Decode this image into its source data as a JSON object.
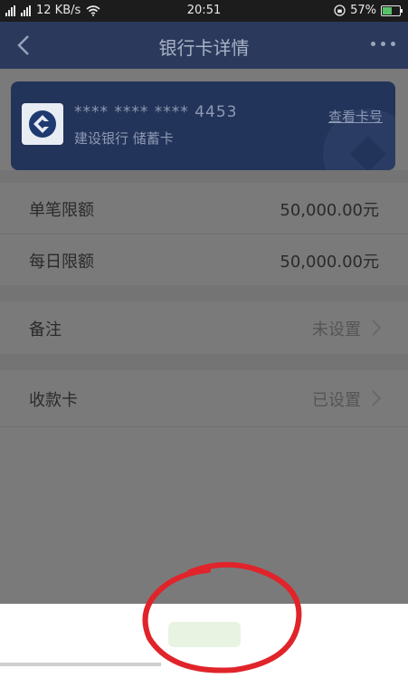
{
  "status_bar": {
    "speed": "12 KB/s",
    "time": "20:51",
    "battery": "57%",
    "battery_level": 0.57
  },
  "header": {
    "title": "银行卡详情"
  },
  "card": {
    "number": "**** **** **** 4453",
    "bank": "建设银行 储蓄卡",
    "view_label": "查看卡号"
  },
  "limits": [
    {
      "label": "单笔限额",
      "value": "50,000.00元"
    },
    {
      "label": "每日限额",
      "value": "50,000.00元"
    }
  ],
  "remark": {
    "label": "备注",
    "value": "未设置"
  },
  "receive_card": {
    "label": "收款卡",
    "value": "已设置"
  },
  "icons": [
    "back-icon",
    "more-icon",
    "bank-logo-icon",
    "chevron-right-icon",
    "wifi-icon",
    "signal-icon",
    "battery-icon"
  ],
  "colors": {
    "header_bg": "#2b3a5c",
    "card_bg": "#23345a",
    "overlay": "#7a7a7a",
    "annotation": "#e0242a"
  }
}
